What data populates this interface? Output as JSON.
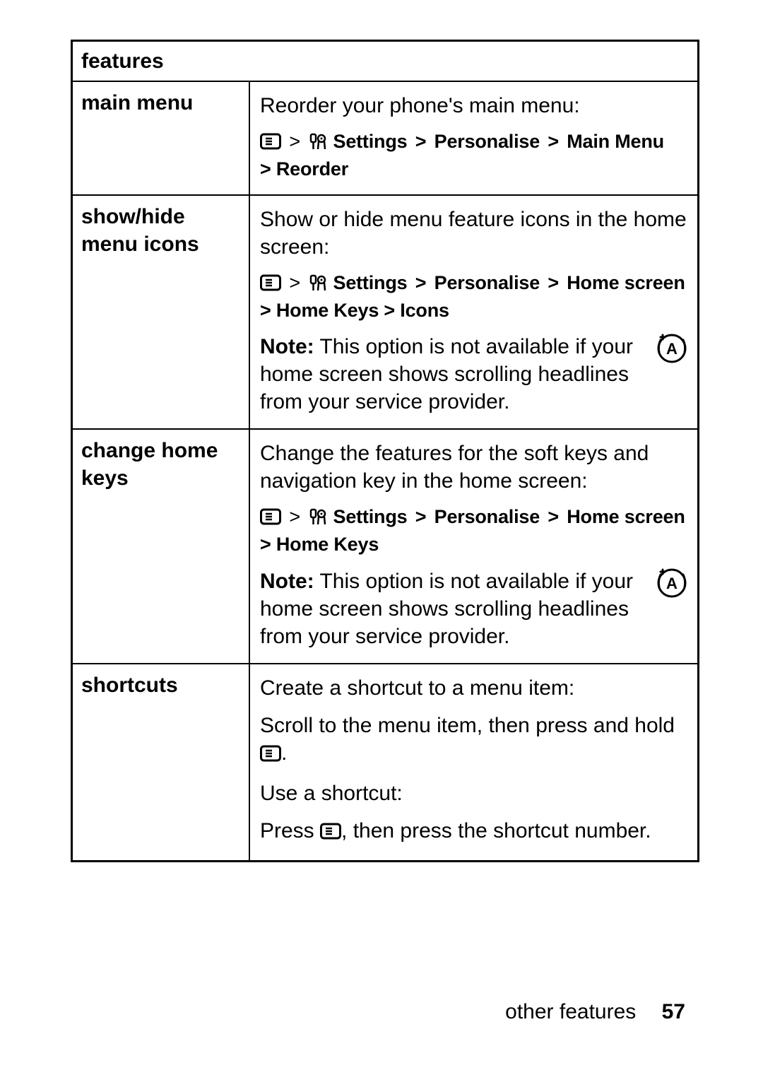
{
  "table": {
    "header": "features",
    "rows": [
      {
        "name": "main menu",
        "desc": "Reorder your phone's main menu:",
        "path_prefix": "",
        "path_a": "Settings",
        "path_b": "Personalise",
        "path_c": "Main Menu",
        "path_line2": "> Reorder"
      },
      {
        "name": "show/hide menu icons",
        "desc": "Show or hide menu feature icons in the home screen:",
        "path_a": "Settings",
        "path_b": "Personalise",
        "path_c": "Home screen",
        "path_line2": "> Home Keys > Icons",
        "note_label": "Note:",
        "note_text": " This option is not available if your home screen shows scrolling headlines from your service provider."
      },
      {
        "name": "change home keys",
        "desc": "Change the features for the soft keys and navigation key in the home screen:",
        "path_a": "Settings",
        "path_b": "Personalise",
        "path_c": "Home screen",
        "path_line2": "> Home Keys",
        "note_label": "Note:",
        "note_text": " This option is not available if your home screen shows scrolling headlines from your service provider."
      },
      {
        "name": "shortcuts",
        "desc": "Create a shortcut to a menu item:",
        "instr1_a": "Scroll to the menu item, then press and hold ",
        "instr1_b": ".",
        "instr2": "Use a shortcut:",
        "instr3_a": "Press ",
        "instr3_b": ", then press the shortcut number."
      }
    ]
  },
  "footer": {
    "label": "other features",
    "page": "57"
  },
  "glyphs": {
    "gt": ">"
  }
}
